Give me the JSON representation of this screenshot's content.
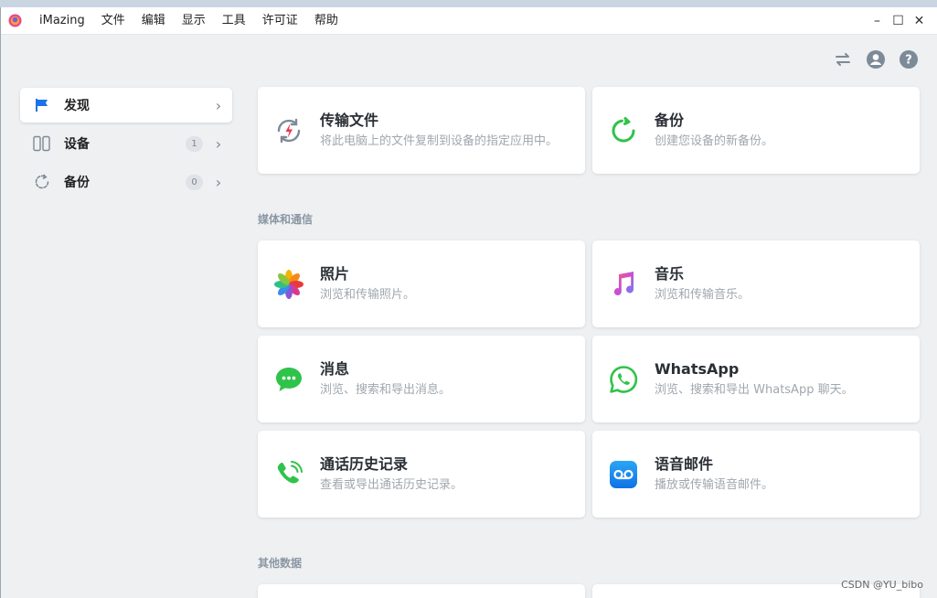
{
  "app": {
    "name": "iMazing"
  },
  "menu": [
    "文件",
    "编辑",
    "显示",
    "工具",
    "许可证",
    "帮助"
  ],
  "window_controls": {
    "minimize": "–",
    "maximize": "☐",
    "close": "✕"
  },
  "sidebar": {
    "items": [
      {
        "label": "发现",
        "badge": "",
        "icon": "flag-icon",
        "active": true
      },
      {
        "label": "设备",
        "badge": "1",
        "icon": "device-icon",
        "active": false
      },
      {
        "label": "备份",
        "badge": "0",
        "icon": "backup-icon",
        "active": false
      }
    ]
  },
  "top_cards": [
    {
      "title": "传输文件",
      "desc": "将此电脑上的文件复制到设备的指定应用中。",
      "icon": "transfer-icon"
    },
    {
      "title": "备份",
      "desc": "创建您设备的新备份。",
      "icon": "backup-icon"
    }
  ],
  "sections": {
    "media": {
      "label": "媒体和通信",
      "cards": [
        {
          "title": "照片",
          "desc": "浏览和传输照片。",
          "icon": "photos-icon"
        },
        {
          "title": "音乐",
          "desc": "浏览和传输音乐。",
          "icon": "music-icon"
        },
        {
          "title": "消息",
          "desc": "浏览、搜索和导出消息。",
          "icon": "messages-icon"
        },
        {
          "title": "WhatsApp",
          "desc": "浏览、搜索和导出 WhatsApp 聊天。",
          "icon": "whatsapp-icon"
        },
        {
          "title": "通话历史记录",
          "desc": "查看或导出通话历史记录。",
          "icon": "phone-icon"
        },
        {
          "title": "语音邮件",
          "desc": "播放或传输语音邮件。",
          "icon": "voicemail-icon"
        }
      ]
    },
    "other": {
      "label": "其他数据"
    }
  },
  "watermark": "CSDN @YU_bibo",
  "colors": {
    "accent": "#1a73e8",
    "green": "#2fc34a",
    "background": "#eef0f2"
  }
}
